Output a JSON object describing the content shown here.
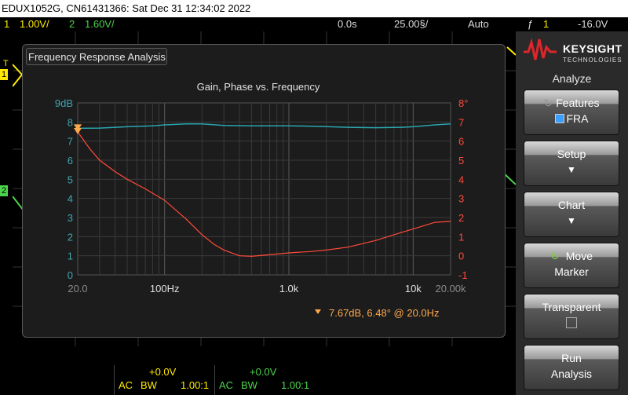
{
  "titlebar": {
    "text": "EDUX1052G, CN61431366: Sat Dec 31 12:34:02 2022"
  },
  "statusbar": {
    "ch1_num": "1",
    "ch1_scale": "1.00V/",
    "ch2_num": "2",
    "ch2_scale": "1.60V/",
    "time_offset": "0.0s",
    "time_scale": "25.00§/",
    "trigger_mode": "Auto",
    "trigger_icon": "ƒ",
    "trigger_ch": "1",
    "trigger_level": "-16.0V"
  },
  "channel_markers": {
    "trig": "T",
    "ch1": "1",
    "ch2": "2"
  },
  "window": {
    "title": "Frequency Response Analysis"
  },
  "chart_data": {
    "type": "line",
    "title": "Gain, Phase vs. Frequency",
    "x_scale": "log",
    "x_ticks": [
      "20.0",
      "100Hz",
      "1.0k",
      "10k",
      "20.00k"
    ],
    "x_range": [
      20,
      20000
    ],
    "gain_axis": {
      "ticks": [
        "9dB",
        "8",
        "7",
        "6",
        "5",
        "4",
        "3",
        "2",
        "1",
        "0"
      ],
      "range": [
        0,
        9
      ],
      "color": "#3fa6b3"
    },
    "phase_axis": {
      "ticks": [
        "8°",
        "7",
        "6",
        "5",
        "4",
        "3",
        "2",
        "1",
        "0",
        "-1"
      ],
      "range": [
        -1,
        8
      ],
      "color": "#ff4a3a"
    },
    "series": [
      {
        "name": "Gain",
        "axis": "gain",
        "color": "#2aa6b0",
        "points": [
          [
            20,
            7.67
          ],
          [
            30,
            7.68
          ],
          [
            50,
            7.75
          ],
          [
            80,
            7.8
          ],
          [
            100,
            7.85
          ],
          [
            150,
            7.9
          ],
          [
            200,
            7.9
          ],
          [
            300,
            7.82
          ],
          [
            500,
            7.8
          ],
          [
            800,
            7.8
          ],
          [
            1000,
            7.8
          ],
          [
            1500,
            7.78
          ],
          [
            2000,
            7.76
          ],
          [
            3000,
            7.72
          ],
          [
            5000,
            7.7
          ],
          [
            8000,
            7.72
          ],
          [
            10000,
            7.75
          ],
          [
            15000,
            7.85
          ],
          [
            20000,
            7.9
          ]
        ]
      },
      {
        "name": "Phase",
        "axis": "phase",
        "color": "#ff4a3a",
        "points": [
          [
            20,
            6.48
          ],
          [
            25,
            5.6
          ],
          [
            30,
            5.0
          ],
          [
            40,
            4.4
          ],
          [
            50,
            4.0
          ],
          [
            70,
            3.5
          ],
          [
            100,
            2.9
          ],
          [
            150,
            1.9
          ],
          [
            200,
            1.1
          ],
          [
            250,
            0.6
          ],
          [
            300,
            0.3
          ],
          [
            400,
            0.0
          ],
          [
            500,
            -0.03
          ],
          [
            700,
            0.05
          ],
          [
            1000,
            0.15
          ],
          [
            1500,
            0.22
          ],
          [
            2000,
            0.3
          ],
          [
            3000,
            0.45
          ],
          [
            5000,
            0.8
          ],
          [
            7000,
            1.1
          ],
          [
            10000,
            1.4
          ],
          [
            15000,
            1.75
          ],
          [
            20000,
            1.8
          ]
        ]
      }
    ],
    "marker": {
      "readout": "7.67dB, 6.48° @ 20.0Hz",
      "freq": 20,
      "gain": 7.67,
      "phase": 6.48,
      "color": "#ffa84a"
    }
  },
  "sidebar": {
    "brand": "KEYSIGHT",
    "brand_sub": "TECHNOLOGIES",
    "header": "Analyze",
    "keys": [
      {
        "line1": "Features",
        "line2": "FRA"
      },
      {
        "line1": "Setup",
        "line2": ""
      },
      {
        "line1": "Chart",
        "line2": ""
      },
      {
        "line1": "Move",
        "line2": "Marker"
      },
      {
        "line1": "Transparent",
        "line2": ""
      },
      {
        "line1": "Run",
        "line2": "Analysis"
      }
    ]
  },
  "bottom": {
    "ch1_offset": "+0.0V",
    "ch1_coupling": "AC",
    "ch1_bw": "BW",
    "ch1_probe": "1.00:1",
    "ch2_offset": "+0.0V",
    "ch2_coupling": "AC",
    "ch2_bw": "BW",
    "ch2_probe": "1.00:1"
  },
  "colors": {
    "ch1": "#ffea00",
    "ch2": "#4cd34c",
    "gain": "#2aa6b0",
    "phase": "#ff4a3a",
    "marker": "#ffa84a"
  }
}
